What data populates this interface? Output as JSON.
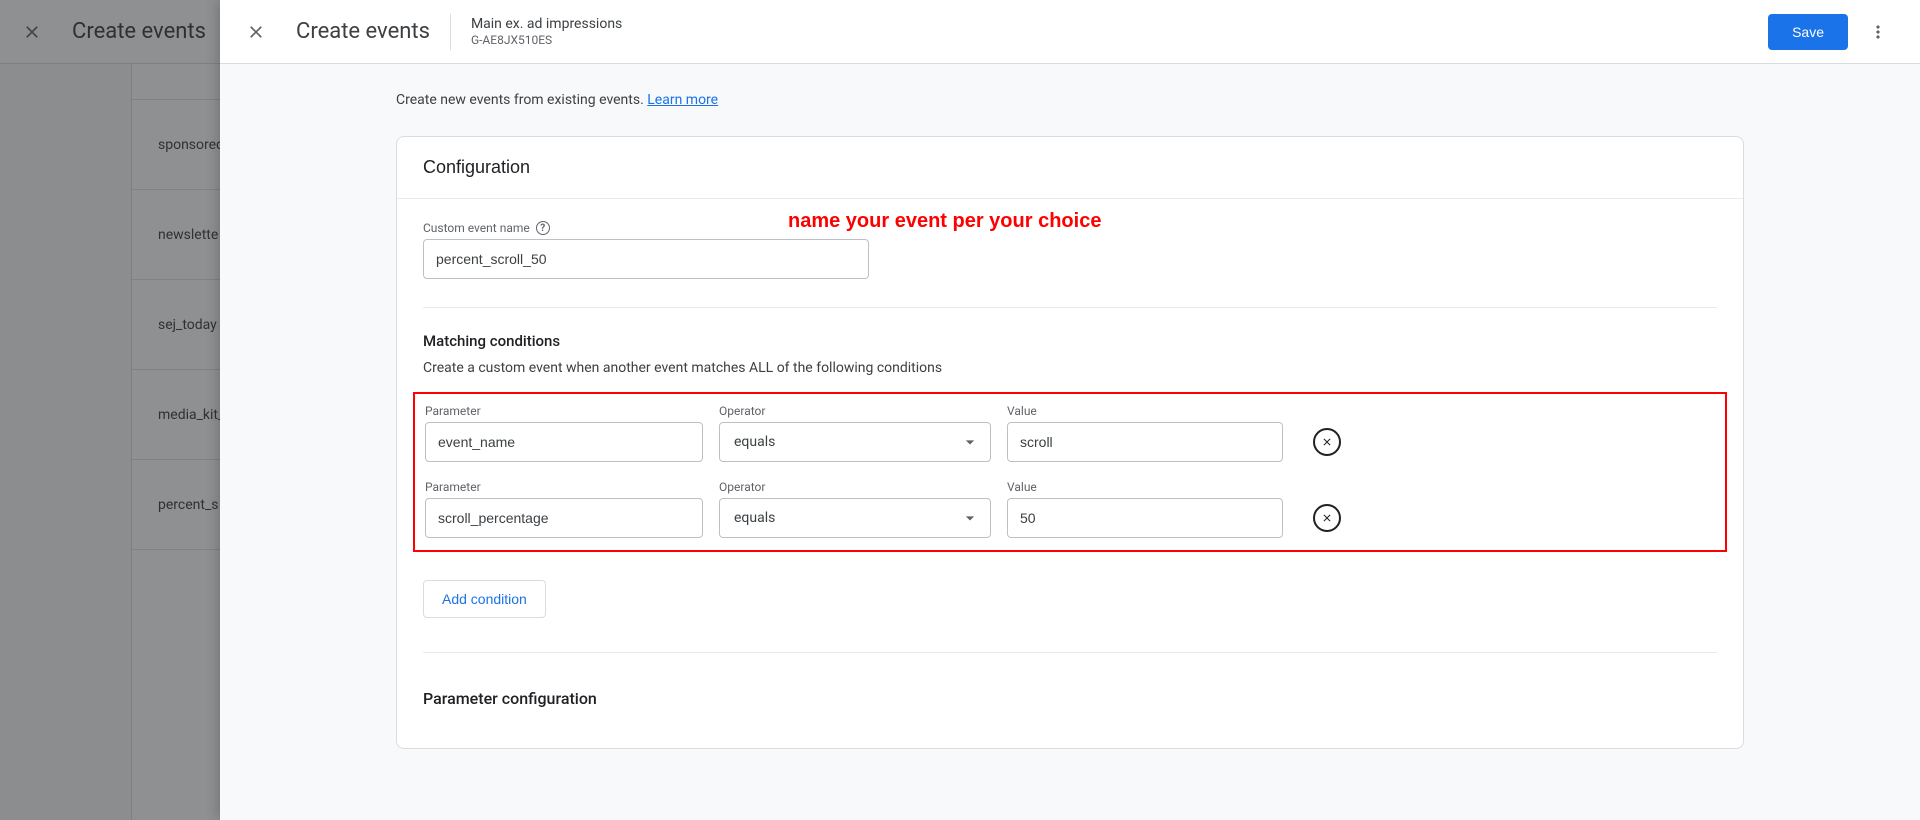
{
  "background": {
    "title": "Create events",
    "items": [
      "",
      "sponsored",
      "newslette",
      "sej_today",
      "media_kit_",
      "percent_s"
    ]
  },
  "panel": {
    "title": "Create events",
    "property_name": "Main ex. ad impressions",
    "property_id": "G-AE8JX510ES",
    "save": "Save",
    "helper_text": "Create new events from existing events. ",
    "learn_more": "Learn more"
  },
  "annotation": "name your event per your choice",
  "config": {
    "card_title": "Configuration",
    "custom_label": "Custom event name",
    "custom_value": "percent_scroll_50",
    "matching_heading": "Matching conditions",
    "matching_sub": "Create a custom event when another event matches ALL of the following conditions",
    "col_parameter": "Parameter",
    "col_operator": "Operator",
    "col_value": "Value",
    "rows": [
      {
        "parameter": "event_name",
        "operator": "equals",
        "value": "scroll"
      },
      {
        "parameter": "scroll_percentage",
        "operator": "equals",
        "value": "50"
      }
    ],
    "add_condition": "Add condition",
    "param_config_heading": "Parameter configuration"
  }
}
